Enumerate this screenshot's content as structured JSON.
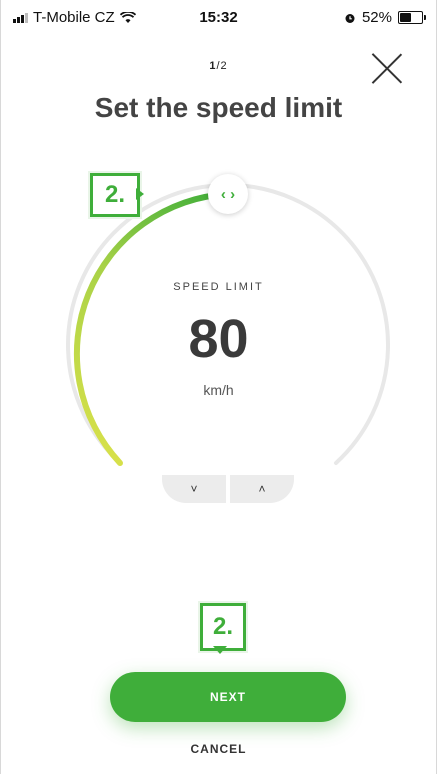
{
  "status_bar": {
    "carrier": "T-Mobile CZ",
    "time": "15:32",
    "battery_percent": "52%",
    "battery_level": 0.52,
    "icons": [
      "signal-icon",
      "wifi-icon",
      "alarm-icon",
      "battery-icon"
    ]
  },
  "header": {
    "step_current": "1",
    "step_separator": "/",
    "step_total": "2",
    "close_icon": "close-icon"
  },
  "title": "Set the speed limit",
  "gauge": {
    "label": "SPEED LIMIT",
    "value": "80",
    "unit": "km/h",
    "handle_icon": "left-right-chevrons-icon",
    "accent": "#3fae3a",
    "accent_start": "#d6e04a",
    "track": "#e8e8e8"
  },
  "stepper": {
    "down_label": "˅",
    "up_label": "˄"
  },
  "annotations": {
    "handle_badge": "2.",
    "next_badge": "2.",
    "badge_color": "#3fae3a"
  },
  "actions": {
    "next_label": "NEXT",
    "cancel_label": "CANCEL"
  }
}
